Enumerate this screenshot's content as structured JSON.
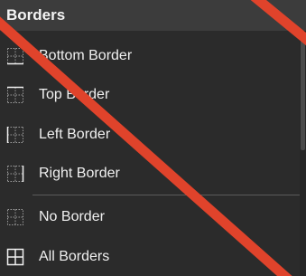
{
  "menu": {
    "section_title": "Borders",
    "items": [
      {
        "label": "Bottom Border",
        "icon": "bottom-border-icon"
      },
      {
        "label": "Top Border",
        "icon": "top-border-icon"
      },
      {
        "label": "Left Border",
        "icon": "left-border-icon"
      },
      {
        "label": "Right Border",
        "icon": "right-border-icon"
      },
      {
        "label": "No Border",
        "icon": "no-border-icon"
      },
      {
        "label": "All Borders",
        "icon": "all-borders-icon"
      }
    ]
  },
  "colors": {
    "background": "#2b2b2b",
    "header_background": "#3c3c3c",
    "text": "#f0f0f0",
    "strike_line": "#e0432b"
  }
}
